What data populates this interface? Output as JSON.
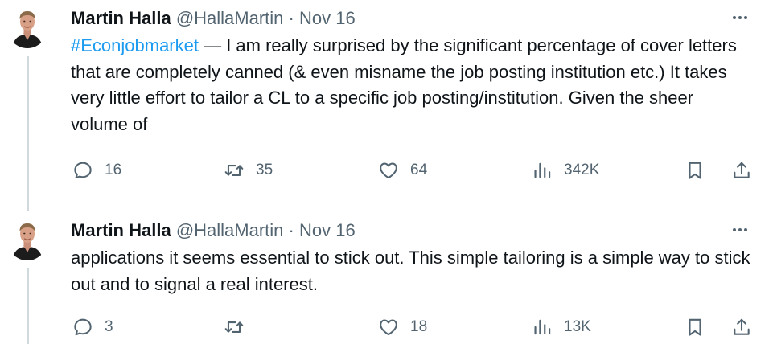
{
  "tweets": [
    {
      "author_name": "Martin Halla",
      "handle": "@HallaMartin",
      "separator": "·",
      "date": "Nov 16",
      "hashtag": "#Econjobmarket",
      "text": " — I am really surprised by the significant percentage of cover letters that are completely canned (& even misname the job posting institution etc.) It takes very little effort to tailor a CL to a specific job posting/institution. Given the sheer volume of",
      "replies": "16",
      "retweets": "35",
      "likes": "64",
      "views": "342K"
    },
    {
      "author_name": "Martin Halla",
      "handle": "@HallaMartin",
      "separator": "·",
      "date": "Nov 16",
      "text": "applications it seems essential to stick out. This simple tailoring is a simple way to stick out and to signal a real interest.",
      "replies": "3",
      "retweets": "",
      "likes": "18",
      "views": "13K"
    }
  ],
  "icons": {
    "reply": "reply-icon",
    "retweet": "retweet-icon",
    "like": "heart-icon",
    "views": "views-icon",
    "bookmark": "bookmark-icon",
    "share": "share-icon",
    "more": "more-icon"
  },
  "colors": {
    "text": "#0f1419",
    "secondary": "#536471",
    "hashtag": "#1d9bf0",
    "thread_line": "#cfd9de"
  }
}
